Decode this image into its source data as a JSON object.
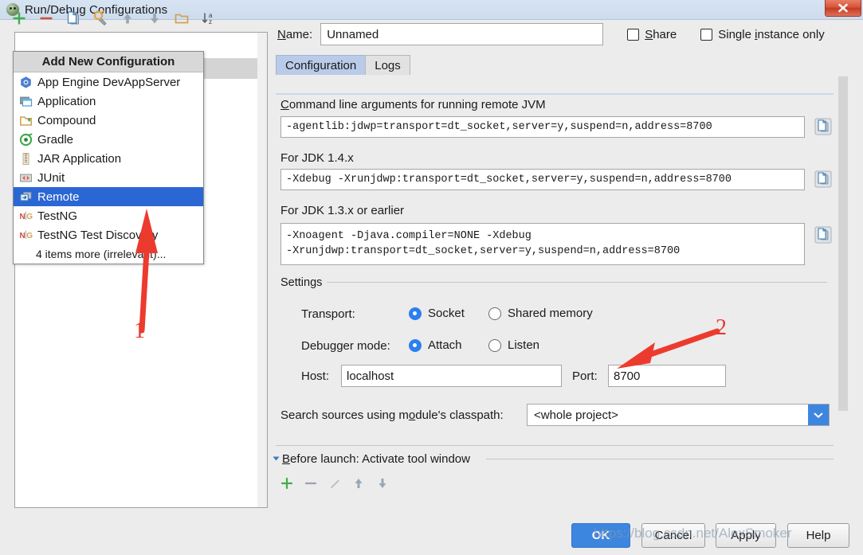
{
  "window": {
    "title": "Run/Debug Configurations",
    "icon": "intellij-idea-icon",
    "close_label": "✕"
  },
  "toolbar": {
    "icons": [
      {
        "name": "add-icon",
        "title": "Add New Configuration"
      },
      {
        "name": "remove-icon",
        "title": "Remove Configuration"
      },
      {
        "name": "copy-icon",
        "title": "Copy Configuration"
      },
      {
        "name": "edit-templates-icon",
        "title": "Edit Templates"
      },
      {
        "name": "move-up-icon",
        "title": "Move Up"
      },
      {
        "name": "move-down-icon",
        "title": "Move Down"
      },
      {
        "name": "new-folder-icon",
        "title": "Create New Folder"
      },
      {
        "name": "sort-alphabetically-icon",
        "title": "Sort Configurations"
      }
    ]
  },
  "popup": {
    "header": "Add New Configuration",
    "items": [
      {
        "label": "App Engine DevAppServer",
        "icon": "app-engine-icon",
        "selected": false
      },
      {
        "label": "Application",
        "icon": "application-icon",
        "selected": false
      },
      {
        "label": "Compound",
        "icon": "compound-icon",
        "selected": false
      },
      {
        "label": "Gradle",
        "icon": "gradle-icon",
        "selected": false
      },
      {
        "label": "JAR Application",
        "icon": "jar-icon",
        "selected": false
      },
      {
        "label": "JUnit",
        "icon": "junit-icon",
        "selected": false
      },
      {
        "label": "Remote",
        "icon": "remote-icon",
        "selected": true
      },
      {
        "label": "TestNG",
        "icon": "testng-icon",
        "selected": false
      },
      {
        "label": "TestNG Test Discovery",
        "icon": "testng-icon",
        "selected": false
      }
    ],
    "more_label": "4 items more (irrelevant)..."
  },
  "form": {
    "name_label": "Name:",
    "name_value": "Unnamed",
    "share_label": "Share",
    "share_checked": false,
    "single_instance_label": "Single instance only",
    "single_instance_checked": false
  },
  "tabs": [
    {
      "label": "Configuration",
      "active": true
    },
    {
      "label": "Logs",
      "active": false
    }
  ],
  "configuration": {
    "cmdline_label": "Command line arguments for running remote JVM",
    "cmdline_value": "-agentlib:jdwp=transport=dt_socket,server=y,suspend=n,address=8700",
    "jdk14_label": "For JDK 1.4.x",
    "jdk14_value": "-Xdebug -Xrunjdwp:transport=dt_socket,server=y,suspend=n,address=8700",
    "jdk13_label": "For JDK 1.3.x or earlier",
    "jdk13_value": "-Xnoagent -Djava.compiler=NONE -Xdebug\n-Xrunjdwp:transport=dt_socket,server=y,suspend=n,address=8700",
    "copy_button_title": "Copy to clipboard"
  },
  "settings": {
    "group_label": "Settings",
    "transport_label": "Transport:",
    "transport_options": [
      {
        "label": "Socket",
        "selected": true
      },
      {
        "label": "Shared memory",
        "selected": false
      }
    ],
    "debugger_mode_label": "Debugger mode:",
    "debugger_mode_options": [
      {
        "label": "Attach",
        "selected": true
      },
      {
        "label": "Listen",
        "selected": false
      }
    ],
    "host_label": "Host:",
    "host_value": "localhost",
    "port_label": "Port:",
    "port_value": "8700"
  },
  "classpath": {
    "label": "Search sources using module's classpath:",
    "value": "<whole project>"
  },
  "before_launch": {
    "label": "Before launch: Activate tool window",
    "icons": [
      {
        "name": "add-task-icon"
      },
      {
        "name": "remove-task-icon"
      },
      {
        "name": "edit-task-icon"
      },
      {
        "name": "task-move-up-icon"
      },
      {
        "name": "task-move-down-icon"
      }
    ]
  },
  "footer": {
    "ok": "OK",
    "cancel": "Cancel",
    "apply": "Apply",
    "help": "Help"
  },
  "annotations": [
    {
      "label": "1",
      "target": "remote-list-item"
    },
    {
      "label": "2",
      "target": "port-field"
    }
  ],
  "watermark": "https://blog.csdn.net/AlexSmoker",
  "colors": {
    "accent_blue": "#3d86e0",
    "selection_blue": "#2a67d4",
    "tab_active": "#b9cbe8",
    "annotation_red": "#e8392e",
    "titlebar": "#d6e3f2",
    "dialog_bg": "#ececed"
  }
}
